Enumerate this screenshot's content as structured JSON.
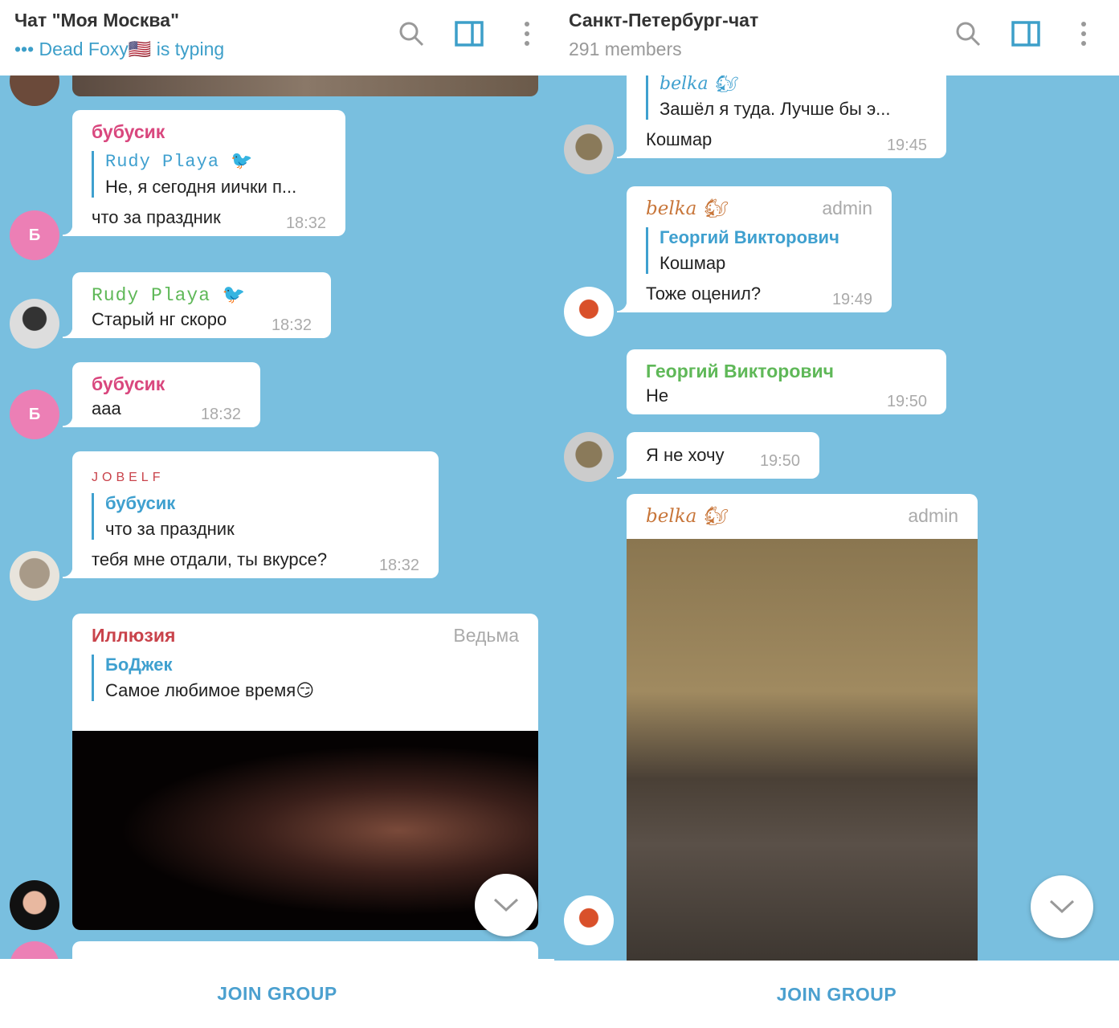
{
  "left": {
    "title": "Чат \"Моя Москва\"",
    "typing": "••• Dead Foxy🇺🇸 is typing",
    "join": "JOIN GROUP",
    "messages": [
      {
        "author": "бубусик",
        "reply_name": "Rudy Playa 🐦",
        "reply_text": "Не, я сегодня иички п...",
        "text": "что за праздник",
        "time": "18:32",
        "avatar": "Б"
      },
      {
        "author": "Rudy Playa 🐦",
        "text": "Старый нг скоро",
        "time": "18:32"
      },
      {
        "author": "бубусик",
        "text": "ааа",
        "time": "18:32",
        "avatar": "Б"
      },
      {
        "author": "JOBELF",
        "reply_name": "бубусик",
        "reply_text": "что за праздник",
        "text": "тебя мне отдали, ты вкурсе?",
        "time": "18:32"
      },
      {
        "author": "Иллюзия",
        "role": "Ведьма",
        "reply_name": "БоДжек",
        "reply_text": "Самое любимое время😏"
      }
    ]
  },
  "right": {
    "title": "Санкт-Петербург-чат",
    "members": "291 members",
    "join": "JOIN GROUP",
    "messages": [
      {
        "reply_name": "belka 🐿",
        "reply_text": "Зашёл я туда. Лучше бы э...",
        "text": "Кошмар",
        "time": "19:45"
      },
      {
        "author": "belka 🐿",
        "role": "admin",
        "reply_name": "Георгий Викторович",
        "reply_text": "Кошмар",
        "text": "Тоже оценил?",
        "time": "19:49"
      },
      {
        "author": "Георгий Викторович",
        "text": "Не",
        "time": "19:50"
      },
      {
        "text": "Я не хочу",
        "time": "19:50"
      },
      {
        "author": "belka 🐿",
        "role": "admin"
      }
    ]
  },
  "colors": {
    "background": "#79bfdf",
    "accent": "#3fa0cf",
    "pink": "#d9477e",
    "red": "#c9434b",
    "green": "#5fb858"
  }
}
